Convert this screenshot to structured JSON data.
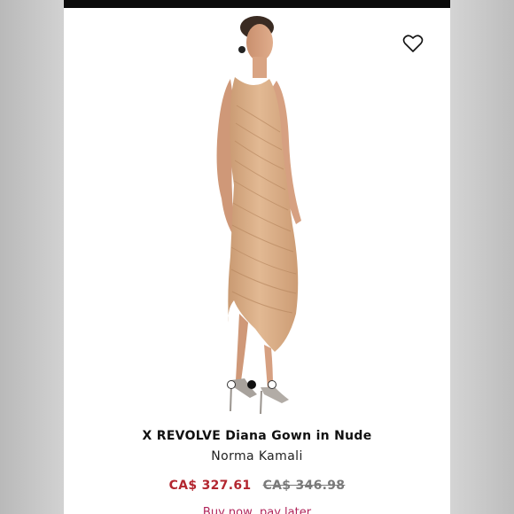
{
  "product": {
    "title": "X REVOLVE Diana Gown in Nude",
    "brand": "Norma Kamali",
    "price_sale": "CA$ 327.61",
    "price_original": "CA$ 346.98",
    "truncated_line": "Buy now, pay later"
  },
  "gallery": {
    "image_count": 3,
    "active_index": 1
  },
  "icons": {
    "favorite": "heart-outline-icon"
  },
  "colors": {
    "sale_price": "#b3262f",
    "dress": "#dcae84"
  }
}
